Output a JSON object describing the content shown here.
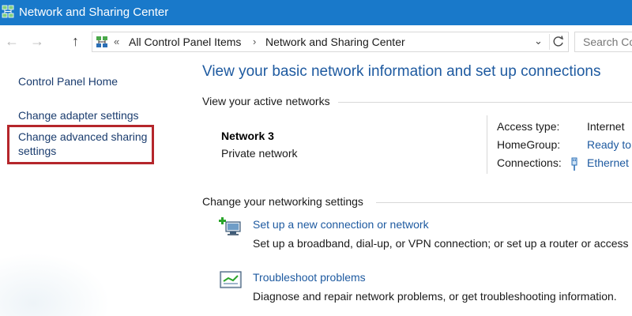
{
  "window": {
    "title": "Network and Sharing Center",
    "icon": "network-and-sharing-icon"
  },
  "navigation": {
    "back_icon": "back-arrow-icon",
    "forward_icon": "forward-arrow-icon",
    "up_icon": "up-arrow-icon",
    "overflow_glyph": "«",
    "breadcrumb": [
      "All Control Panel Items",
      "Network and Sharing Center"
    ],
    "separator": "›",
    "dropdown_icon": "chevron-down-icon",
    "refresh_icon": "refresh-icon",
    "search_placeholder": "Search Co"
  },
  "sidebar": {
    "home_label": "Control Panel Home",
    "adapter_label": "Change adapter settings",
    "advanced_label_line1": "Change advanced sharing",
    "advanced_label_line2": "settings",
    "highlight_color": "#b5262b"
  },
  "main": {
    "heading": "View your basic network information and set up connections",
    "active_networks_label": "View your active networks",
    "network": {
      "name": "Network  3",
      "type": "Private network",
      "access_type_label": "Access type:",
      "access_type_value": "Internet",
      "homegroup_label": "HomeGroup:",
      "homegroup_value": "Ready to",
      "connections_label": "Connections:",
      "connections_value": "Ethernet",
      "connections_icon": "ethernet-icon"
    },
    "change_settings_label": "Change your networking settings",
    "tasks": [
      {
        "icon": "new-connection-icon",
        "link": "Set up a new connection or network",
        "description": "Set up a broadband, dial-up, or VPN connection; or set up a router or access"
      },
      {
        "icon": "troubleshoot-icon",
        "link": "Troubleshoot problems",
        "description": "Diagnose and repair network problems, or get troubleshooting information."
      }
    ]
  },
  "colors": {
    "titlebar": "#1979ca",
    "link": "#1e5aa0",
    "sidebar_link": "#1a3c6e"
  }
}
